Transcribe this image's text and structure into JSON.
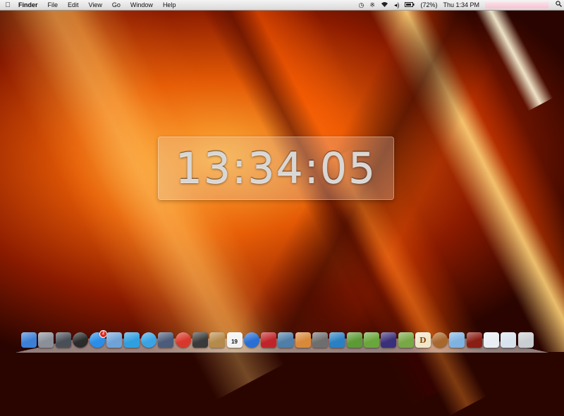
{
  "menubar": {
    "apple_icon": "apple-icon",
    "app_name": "Finder",
    "menus": [
      "File",
      "Edit",
      "View",
      "Go",
      "Window",
      "Help"
    ],
    "status": {
      "time_machine_icon": "time-machine-icon",
      "bluetooth_icon": "bluetooth-icon",
      "wifi_icon": "wifi-icon",
      "volume_icon": "volume-icon",
      "battery_text": "(72%)",
      "clock_text": "Thu 1:34 PM",
      "spotlight_icon": "spotlight-icon"
    }
  },
  "clock_widget": {
    "time": "13:34:05"
  },
  "dock": {
    "icons": [
      {
        "name": "finder-icon",
        "color": "#3b7fd6"
      },
      {
        "name": "launchpad-icon",
        "color": "#8a8f98"
      },
      {
        "name": "mission-control-icon",
        "color": "#4a4f57"
      },
      {
        "name": "dashboard-icon",
        "color": "#2b2b2b"
      },
      {
        "name": "app-store-icon",
        "color": "#2a8ee8",
        "badge": "2"
      },
      {
        "name": "preview-icon",
        "color": "#6fa3d8"
      },
      {
        "name": "twitter-icon",
        "color": "#2f9fe0"
      },
      {
        "name": "safari-icon",
        "color": "#3aa3e3"
      },
      {
        "name": "scripts-icon",
        "color": "#4b5b7a"
      },
      {
        "name": "chrome-icon",
        "color": "#d8382b"
      },
      {
        "name": "facetime-icon",
        "color": "#3a3a3a"
      },
      {
        "name": "contacts-icon",
        "color": "#b58a4a"
      },
      {
        "name": "calendar-icon",
        "color": "#f2f2f2",
        "day": "19"
      },
      {
        "name": "itunes-icon",
        "color": "#2a6fd3"
      },
      {
        "name": "photo-booth-icon",
        "color": "#c0242a"
      },
      {
        "name": "iphoto-icon",
        "color": "#4f7ea8"
      },
      {
        "name": "image-capture-icon",
        "color": "#d8893a"
      },
      {
        "name": "screenshot-icon",
        "color": "#6e6e6e"
      },
      {
        "name": "xcode-icon",
        "color": "#2a80c2"
      },
      {
        "name": "minecraft-icon",
        "color": "#5c9a35"
      },
      {
        "name": "minecraft-2-icon",
        "color": "#6aa63c"
      },
      {
        "name": "cube-icon",
        "color": "#3a2f7a"
      },
      {
        "name": "minecraft-3-icon",
        "color": "#78a846"
      },
      {
        "name": "dictionary-icon",
        "color": "#f0e6c8",
        "letter": "D"
      },
      {
        "name": "coffee-icon",
        "color": "#a8672d"
      },
      {
        "name": "applications-folder-icon",
        "color": "#7fb2e0"
      },
      {
        "name": "downloads-folder-icon",
        "color": "#8a1d14"
      },
      {
        "name": "documents-stack-icon",
        "color": "#e9eef3"
      },
      {
        "name": "preview-stack-icon",
        "color": "#d7e2ee"
      },
      {
        "name": "trash-icon",
        "color": "#c9cdd2"
      }
    ]
  }
}
